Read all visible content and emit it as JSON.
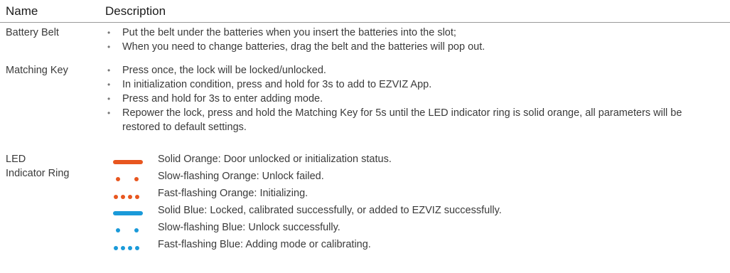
{
  "header": {
    "name": "Name",
    "description": "Description"
  },
  "colors": {
    "orange": "#e8561f",
    "blue": "#1a9ad9"
  },
  "battery_belt": {
    "name": "Battery Belt",
    "bullets": [
      "Put the belt under the batteries when you insert the batteries into the slot;",
      "When you need to change batteries, drag the belt and the batteries will pop out."
    ]
  },
  "matching_key": {
    "name": "Matching Key",
    "bullets": [
      "Press once, the lock will be locked/unlocked.",
      "In initialization condition, press and hold for 3s to add to EZVIZ App.",
      "Press and hold for 3s to enter adding mode.",
      "Repower the lock, press and hold the Matching Key for 5s until the LED indicator ring is solid orange, all parameters will be restored to default settings."
    ]
  },
  "led_ring": {
    "name_line1": "LED",
    "name_line2": "Indicator Ring",
    "rows": [
      {
        "pattern": "solid",
        "color": "orange",
        "text": "Solid Orange: Door unlocked or initialization status."
      },
      {
        "pattern": "slow",
        "color": "orange",
        "text": "Slow-flashing Orange: Unlock failed."
      },
      {
        "pattern": "fast",
        "color": "orange",
        "text": "Fast-flashing Orange: Initializing."
      },
      {
        "pattern": "solid",
        "color": "blue",
        "text": "Solid Blue: Locked, calibrated successfully, or added to EZVIZ successfully."
      },
      {
        "pattern": "slow",
        "color": "blue",
        "text": "Slow-flashing Blue: Unlock successfully."
      },
      {
        "pattern": "fast",
        "color": "blue",
        "text": "Fast-flashing Blue: Adding mode or calibrating."
      }
    ]
  }
}
